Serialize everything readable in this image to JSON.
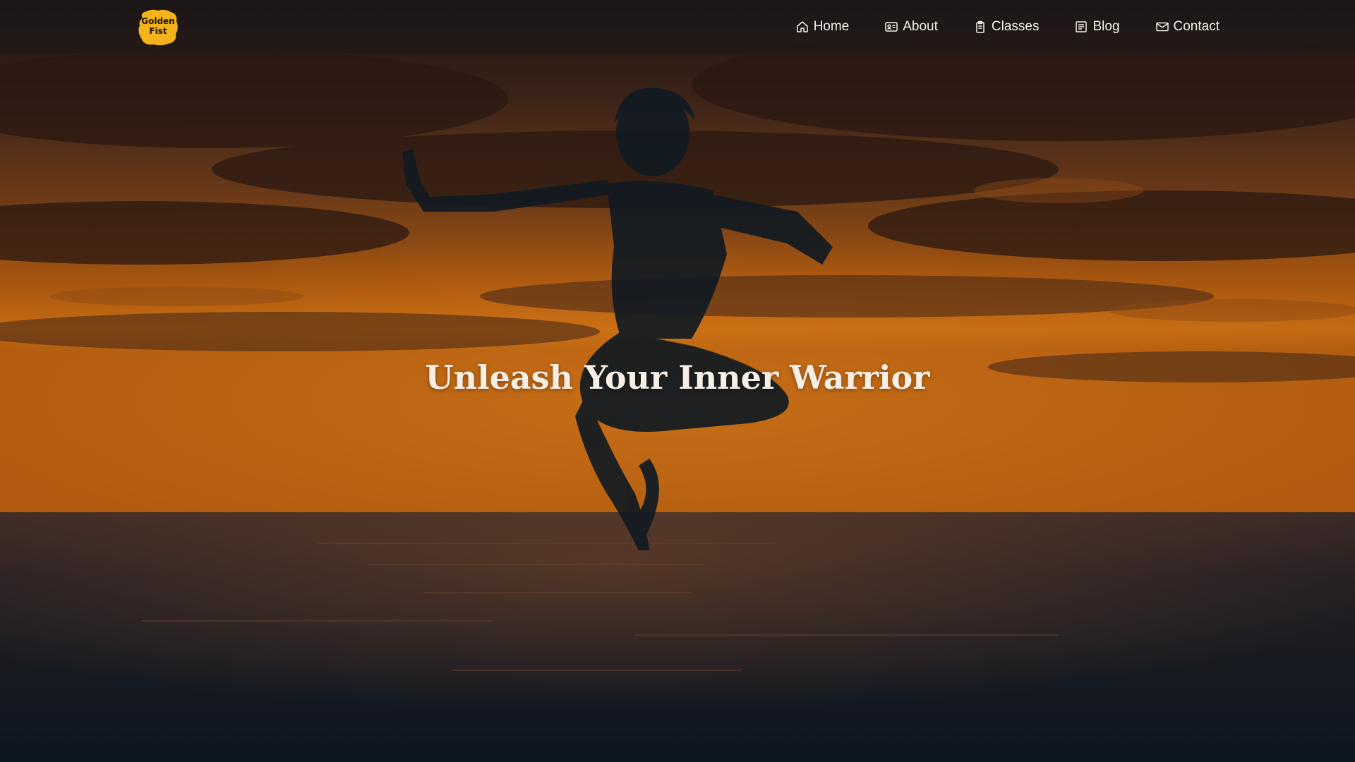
{
  "brand": {
    "logo_line1": "Golden",
    "logo_line2": "Fist",
    "logo_color": "#f5b31b"
  },
  "nav": {
    "items": [
      {
        "label": "Home",
        "icon": "home-icon"
      },
      {
        "label": "About",
        "icon": "id-card-icon"
      },
      {
        "label": "Classes",
        "icon": "clipboard-icon"
      },
      {
        "label": "Blog",
        "icon": "document-icon"
      },
      {
        "label": "Contact",
        "icon": "envelope-icon"
      }
    ]
  },
  "hero": {
    "title": "Unleash Your Inner Warrior"
  },
  "colors": {
    "sky_orange": "#c86a14",
    "sky_dark": "#2a1a15",
    "sea_dark": "#0f1a24",
    "text_light": "#f4efe8"
  }
}
